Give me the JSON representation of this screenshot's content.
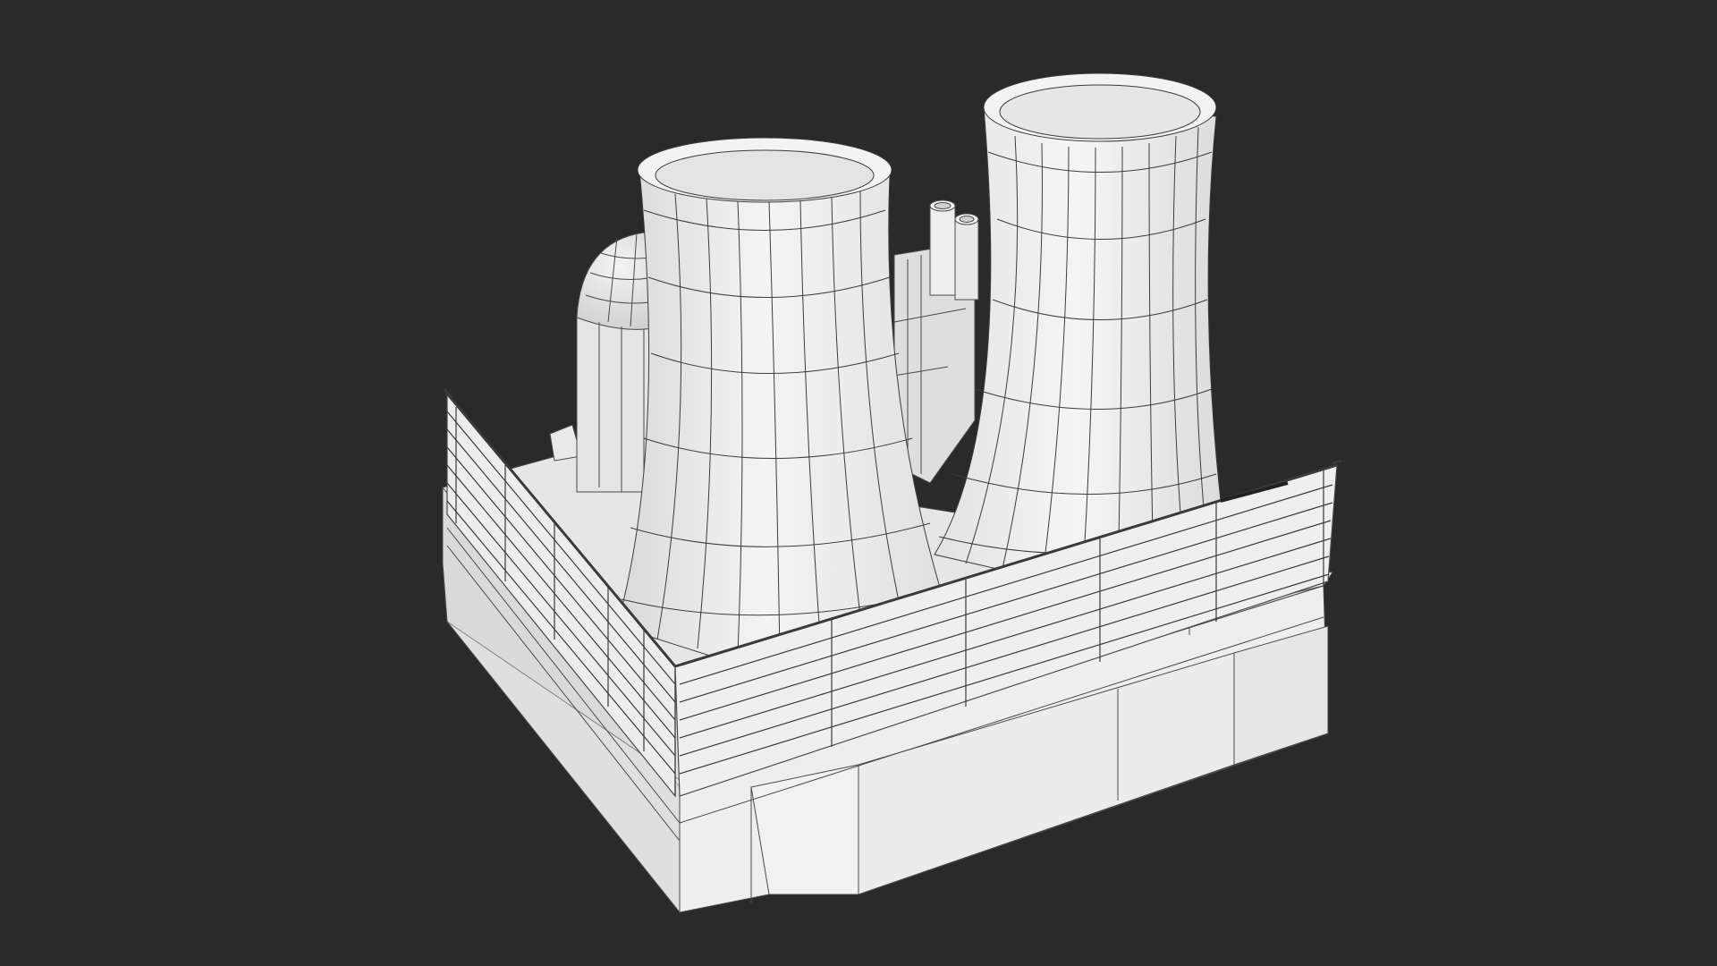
{
  "scene": {
    "subject": "",
    "background_color": "#2a2a2a",
    "mesh_fill_light": "#f2f2f2",
    "mesh_fill_mid": "#e2e2e2",
    "mesh_fill_dark": "#cfcfcf",
    "wire_color": "#3a3a3a",
    "render_mode": "wireframe-on-shaded",
    "objects": [
      "base-platform",
      "cooling-tower-left",
      "cooling-tower-right",
      "dome-tank",
      "chimney-stacks",
      "fence-left",
      "fence-right"
    ]
  }
}
